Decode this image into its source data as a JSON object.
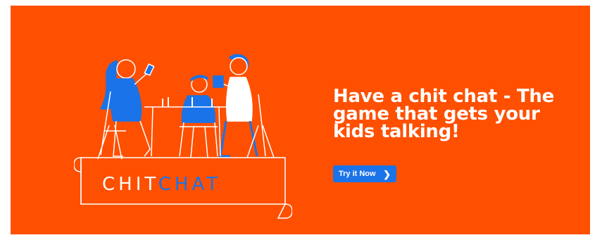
{
  "banner": {
    "background_color": "#fe5000",
    "headline": "Have a chit chat - The game that gets your kids talking!",
    "cta": {
      "label": "Try it Now",
      "icon": "chevron-right-icon",
      "color": "#1a73e8"
    }
  },
  "logo": {
    "part1": "CHIT",
    "part2": "CHAT",
    "part1_color": "#ffffff",
    "part2_color": "#1a73e8"
  }
}
